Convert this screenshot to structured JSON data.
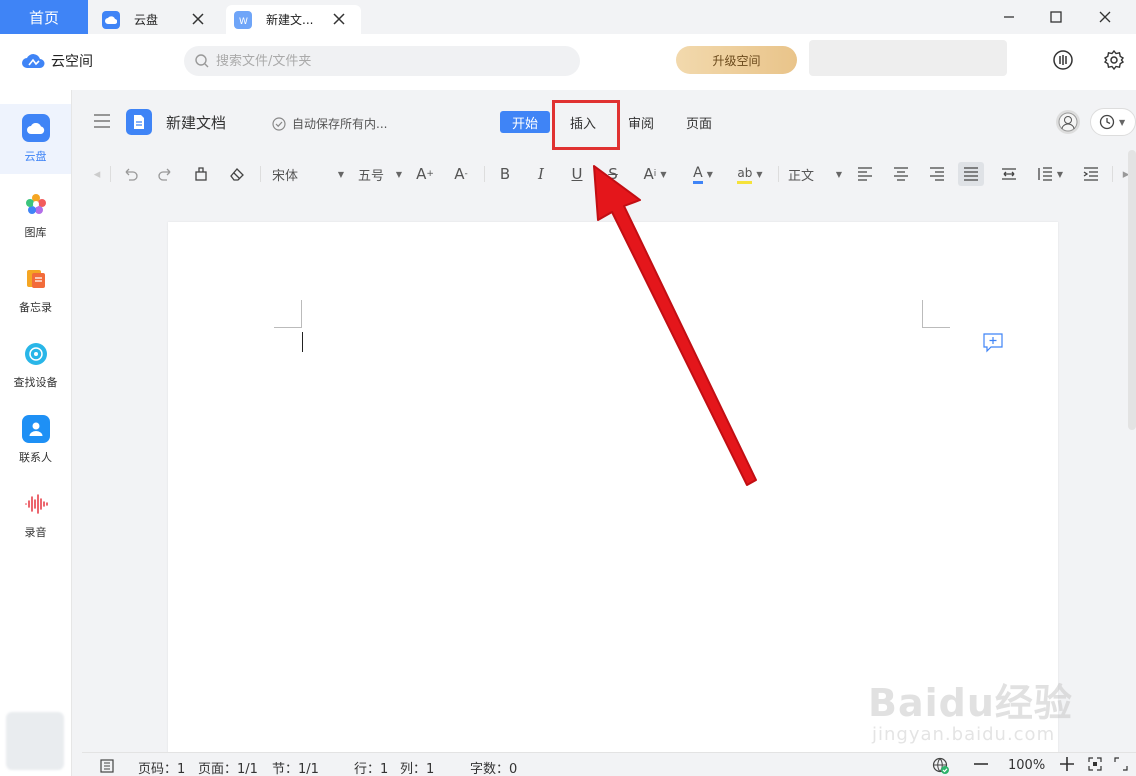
{
  "titlebar": {
    "home_label": "首页",
    "tabs": [
      {
        "label": "云盘",
        "icon": "cloud-icon"
      },
      {
        "label": "新建文...",
        "icon": "word-doc-icon"
      }
    ]
  },
  "header": {
    "brand": "云空间",
    "search_placeholder": "搜索文件/文件夹",
    "upgrade_label": "升级空间"
  },
  "sidebar": {
    "items": [
      {
        "label": "云盘",
        "icon": "cloud-icon",
        "active": true
      },
      {
        "label": "图库",
        "icon": "gallery-icon"
      },
      {
        "label": "备忘录",
        "icon": "notes-icon"
      },
      {
        "label": "查找设备",
        "icon": "find-device-icon"
      },
      {
        "label": "联系人",
        "icon": "contacts-icon"
      },
      {
        "label": "录音",
        "icon": "recorder-icon"
      }
    ]
  },
  "document": {
    "title": "新建文档",
    "autosave": "自动保存所有内...",
    "ribbon_tabs": [
      "开始",
      "插入",
      "审阅",
      "页面"
    ],
    "active_tab": "开始",
    "highlighted_tab": "插入"
  },
  "toolbar": {
    "font_name": "宋体",
    "font_size": "五号",
    "paragraph_style": "正文",
    "bold": "B",
    "italic": "I",
    "underline": "U",
    "strike": "S"
  },
  "statusbar": {
    "page_num": "页码：1",
    "pages": "页面：1/1",
    "section": "节：1/1",
    "line": "行：1",
    "column": "列：1",
    "word_count": "字数：0",
    "zoom": "100%"
  },
  "watermark": {
    "brand": "Baidu经验",
    "url": "jingyan.baidu.com"
  },
  "colors": {
    "accent": "#3f84f6",
    "annotation": "#e03131",
    "upgrade_gold": "#e9c48a"
  }
}
